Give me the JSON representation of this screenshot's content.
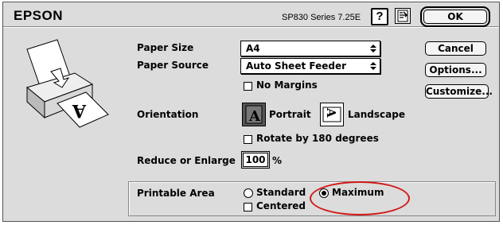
{
  "header": {
    "brand": "EPSON",
    "version": "SP830 Series 7.25E"
  },
  "buttons": {
    "ok": "OK",
    "cancel": "Cancel",
    "options": "Options...",
    "customize": "Customize..."
  },
  "fields": {
    "paper_size": {
      "label": "Paper Size",
      "value": "A4"
    },
    "paper_source": {
      "label": "Paper Source",
      "value": "Auto Sheet Feeder"
    },
    "no_margins": {
      "label": "No Margins",
      "checked": false
    },
    "orientation": {
      "label": "Orientation",
      "portrait": "Portrait",
      "landscape": "Landscape",
      "selected": "Portrait"
    },
    "rotate": {
      "label": "Rotate by 180 degrees",
      "checked": false
    },
    "reduce": {
      "label": "Reduce or Enlarge",
      "value": "100",
      "unit": "%"
    }
  },
  "printable_area": {
    "label": "Printable Area",
    "standard": "Standard",
    "maximum": "Maximum",
    "selected": "Maximum",
    "centered": {
      "label": "Centered",
      "checked": false
    }
  },
  "colors": {
    "highlight_ellipse": "#d11a1a"
  }
}
